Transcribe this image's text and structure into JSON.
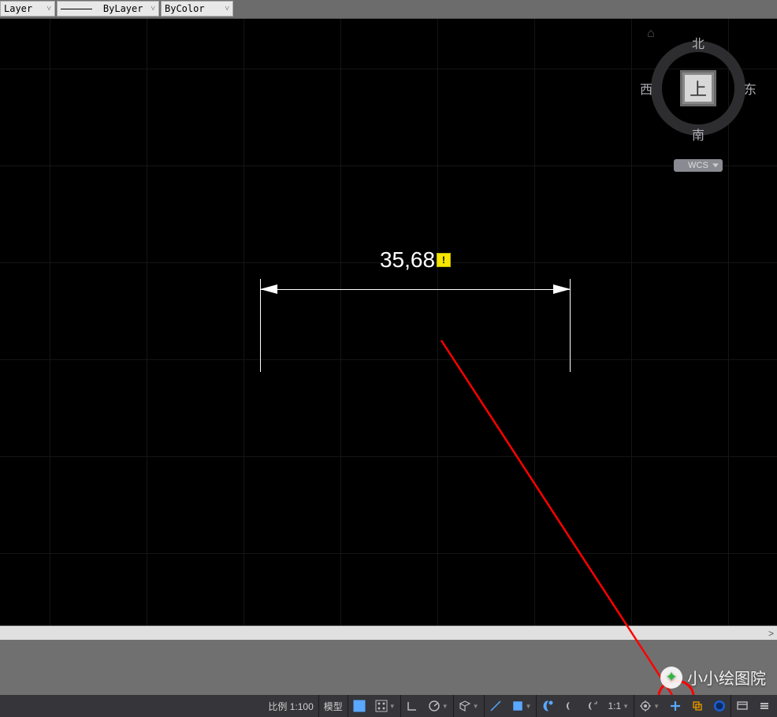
{
  "toolbar": {
    "layerDropdown": "Layer",
    "linetypeDropdown": "ByLayer",
    "colorDropdown": "ByColor"
  },
  "viewcube": {
    "top": "上",
    "north": "北",
    "south": "南",
    "west": "西",
    "east": "东",
    "wcs": "WCS"
  },
  "dimension": {
    "value": "35,68"
  },
  "statusbar": {
    "scale": "比例 1:100",
    "model": "模型",
    "ratio": "1:1"
  },
  "hscroll": {
    "rightArrow": ">"
  },
  "watermark": {
    "text": "小小绘图院"
  }
}
